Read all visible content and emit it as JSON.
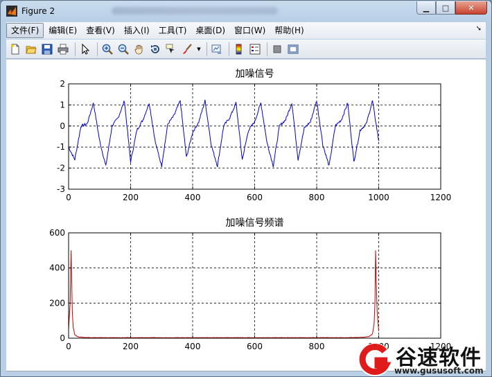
{
  "window": {
    "title": "Figure 2"
  },
  "menu": [
    {
      "label": "文件(F)"
    },
    {
      "label": "编辑(E)"
    },
    {
      "label": "查看(V)"
    },
    {
      "label": "插入(I)"
    },
    {
      "label": "工具(T)"
    },
    {
      "label": "桌面(D)"
    },
    {
      "label": "窗口(W)"
    },
    {
      "label": "帮助(H)"
    }
  ],
  "toolbar_icons": [
    "new-figure-icon",
    "open-file-icon",
    "save-icon",
    "print-icon",
    "select-arrow-icon",
    "zoom-in-icon",
    "zoom-out-icon",
    "pan-hand-icon",
    "rotate-3d-icon",
    "data-cursor-icon",
    "brush-icon",
    "link-plot-icon",
    "colorbar-icon",
    "legend-icon",
    "hide-plot-tools-icon",
    "show-plot-tools-icon"
  ],
  "colors": {
    "signal": "#0000c8",
    "spectrum": "#c00000",
    "grid": "#000000"
  },
  "watermark": {
    "name": "谷速软件",
    "url": "www.gususoft.com"
  },
  "chart_data": [
    {
      "type": "line",
      "title": "加噪信号",
      "xlim": [
        0,
        1200
      ],
      "ylim": [
        -3,
        2
      ],
      "xticks": [
        0,
        200,
        400,
        600,
        800,
        1000,
        1200
      ],
      "yticks": [
        -3,
        -2,
        -1,
        0,
        1,
        2
      ],
      "grid": true,
      "series": [
        {
          "description": "noisy periodic signal, period approx 100 samples, x 0 to 1000",
          "x": [
            0,
            20,
            40,
            60,
            80,
            100,
            120,
            140,
            160,
            180,
            200,
            220,
            240,
            260,
            280,
            300,
            320,
            340,
            360,
            380,
            400,
            420,
            440,
            460,
            480,
            500,
            520,
            540,
            560,
            580,
            600,
            620,
            640,
            660,
            680,
            700,
            720,
            740,
            760,
            780,
            800,
            820,
            840,
            860,
            880,
            900,
            920,
            940,
            960,
            980,
            1000
          ],
          "y": [
            -1.0,
            -1.6,
            0.0,
            0.1,
            1.1,
            -0.7,
            -1.9,
            0.0,
            0.4,
            1.2,
            -1.7,
            -0.2,
            0.3,
            1.1,
            -0.8,
            -1.9,
            0.1,
            0.5,
            1.2,
            -1.5,
            -0.3,
            0.2,
            1.2,
            -0.9,
            -1.9,
            0.0,
            0.4,
            1.1,
            -1.6,
            -0.2,
            0.2,
            1.1,
            -0.8,
            -1.9,
            0.0,
            0.3,
            1.1,
            -1.6,
            -0.1,
            0.2,
            1.2,
            -0.9,
            -1.9,
            0.0,
            0.3,
            1.1,
            -1.7,
            -0.2,
            0.1,
            1.2,
            -0.7
          ]
        }
      ]
    },
    {
      "type": "line",
      "title": "加噪信号频谱",
      "xlim": [
        0,
        1200
      ],
      "ylim": [
        0,
        600
      ],
      "xticks": [
        0,
        200,
        400,
        600,
        800,
        1000,
        1200
      ],
      "yticks": [
        0,
        200,
        400,
        600
      ],
      "grid": true,
      "series": [
        {
          "description": "magnitude spectrum with peaks near x=10 and x=990",
          "x": [
            0,
            5,
            8,
            10,
            12,
            15,
            20,
            30,
            50,
            100,
            300,
            500,
            700,
            900,
            950,
            970,
            980,
            985,
            988,
            990,
            992,
            995,
            1000
          ],
          "y": [
            50,
            200,
            500,
            330,
            150,
            60,
            20,
            8,
            4,
            3,
            3,
            3,
            3,
            3,
            5,
            10,
            25,
            80,
            200,
            500,
            330,
            150,
            40
          ]
        }
      ]
    }
  ]
}
